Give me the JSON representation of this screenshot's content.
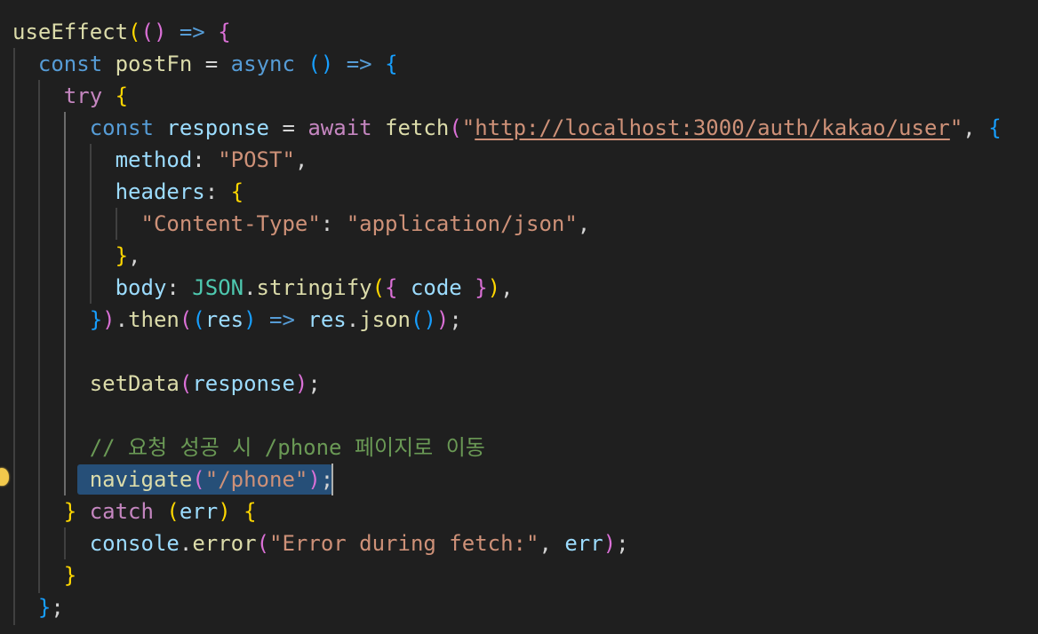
{
  "editor": {
    "lines": [
      [
        [
          "fn",
          "useEffect"
        ],
        [
          "b1",
          "("
        ],
        [
          "b2",
          "()"
        ],
        [
          "punc",
          " "
        ],
        [
          "kw",
          "=>"
        ],
        [
          "punc",
          " "
        ],
        [
          "b2",
          "{"
        ]
      ],
      [
        [
          "punc",
          "  "
        ],
        [
          "kw",
          "const"
        ],
        [
          "punc",
          " "
        ],
        [
          "fn",
          "postFn"
        ],
        [
          "punc",
          " = "
        ],
        [
          "kw",
          "async"
        ],
        [
          "punc",
          " "
        ],
        [
          "b3",
          "()"
        ],
        [
          "punc",
          " "
        ],
        [
          "kw",
          "=>"
        ],
        [
          "punc",
          " "
        ],
        [
          "b3",
          "{"
        ]
      ],
      [
        [
          "punc",
          "    "
        ],
        [
          "ctl",
          "try"
        ],
        [
          "punc",
          " "
        ],
        [
          "b1",
          "{"
        ]
      ],
      [
        [
          "punc",
          "      "
        ],
        [
          "kw",
          "const"
        ],
        [
          "punc",
          " "
        ],
        [
          "var",
          "response"
        ],
        [
          "punc",
          " = "
        ],
        [
          "ctl",
          "await"
        ],
        [
          "punc",
          " "
        ],
        [
          "fn",
          "fetch"
        ],
        [
          "b2",
          "("
        ],
        [
          "str",
          "\""
        ],
        [
          "url",
          "http://localhost:3000/auth/kakao/user"
        ],
        [
          "str",
          "\""
        ],
        [
          "punc",
          ", "
        ],
        [
          "b3",
          "{"
        ]
      ],
      [
        [
          "punc",
          "        "
        ],
        [
          "var",
          "method"
        ],
        [
          "punc",
          ": "
        ],
        [
          "str",
          "\"POST\""
        ],
        [
          "punc",
          ","
        ]
      ],
      [
        [
          "punc",
          "        "
        ],
        [
          "var",
          "headers"
        ],
        [
          "punc",
          ": "
        ],
        [
          "b1",
          "{"
        ]
      ],
      [
        [
          "punc",
          "          "
        ],
        [
          "str",
          "\"Content-Type\""
        ],
        [
          "punc",
          ": "
        ],
        [
          "str",
          "\"application/json\""
        ],
        [
          "punc",
          ","
        ]
      ],
      [
        [
          "punc",
          "        "
        ],
        [
          "b1",
          "}"
        ],
        [
          "punc",
          ","
        ]
      ],
      [
        [
          "punc",
          "        "
        ],
        [
          "var",
          "body"
        ],
        [
          "punc",
          ": "
        ],
        [
          "cls",
          "JSON"
        ],
        [
          "punc",
          "."
        ],
        [
          "fn",
          "stringify"
        ],
        [
          "b1",
          "("
        ],
        [
          "b2",
          "{"
        ],
        [
          "punc",
          " "
        ],
        [
          "var",
          "code"
        ],
        [
          "punc",
          " "
        ],
        [
          "b2",
          "}"
        ],
        [
          "b1",
          ")"
        ],
        [
          "punc",
          ","
        ]
      ],
      [
        [
          "punc",
          "      "
        ],
        [
          "b3",
          "}"
        ],
        [
          "b2",
          ")"
        ],
        [
          "punc",
          "."
        ],
        [
          "fn",
          "then"
        ],
        [
          "b2",
          "("
        ],
        [
          "b3",
          "("
        ],
        [
          "var",
          "res"
        ],
        [
          "b3",
          ")"
        ],
        [
          "punc",
          " "
        ],
        [
          "kw",
          "=>"
        ],
        [
          "punc",
          " "
        ],
        [
          "var",
          "res"
        ],
        [
          "punc",
          "."
        ],
        [
          "fn",
          "json"
        ],
        [
          "b3",
          "()"
        ],
        [
          "b2",
          ")"
        ],
        [
          "punc",
          ";"
        ]
      ],
      [],
      [
        [
          "punc",
          "      "
        ],
        [
          "fn",
          "setData"
        ],
        [
          "b2",
          "("
        ],
        [
          "var",
          "response"
        ],
        [
          "b2",
          ")"
        ],
        [
          "punc",
          ";"
        ]
      ],
      [],
      [
        [
          "punc",
          "      "
        ],
        [
          "cmt",
          "// 요청 성공 시 /phone 페이지로 이동"
        ]
      ],
      [
        [
          "punc",
          "      "
        ],
        [
          "fn",
          "navigate"
        ],
        [
          "b2",
          "("
        ],
        [
          "str",
          "\"/phone\""
        ],
        [
          "b2",
          ")"
        ],
        [
          "punc",
          ";"
        ]
      ],
      [
        [
          "punc",
          "    "
        ],
        [
          "b1",
          "}"
        ],
        [
          "punc",
          " "
        ],
        [
          "ctl",
          "catch"
        ],
        [
          "punc",
          " "
        ],
        [
          "b1",
          "("
        ],
        [
          "var",
          "err"
        ],
        [
          "b1",
          ")"
        ],
        [
          "punc",
          " "
        ],
        [
          "b1",
          "{"
        ]
      ],
      [
        [
          "punc",
          "      "
        ],
        [
          "var",
          "console"
        ],
        [
          "punc",
          "."
        ],
        [
          "fn",
          "error"
        ],
        [
          "b2",
          "("
        ],
        [
          "str",
          "\"Error during fetch:\""
        ],
        [
          "punc",
          ", "
        ],
        [
          "var",
          "err"
        ],
        [
          "b2",
          ")"
        ],
        [
          "punc",
          ";"
        ]
      ],
      [
        [
          "punc",
          "    "
        ],
        [
          "b1",
          "}"
        ]
      ],
      [
        [
          "punc",
          "  "
        ],
        [
          "b3",
          "}"
        ],
        [
          "punc",
          ";"
        ]
      ]
    ]
  }
}
